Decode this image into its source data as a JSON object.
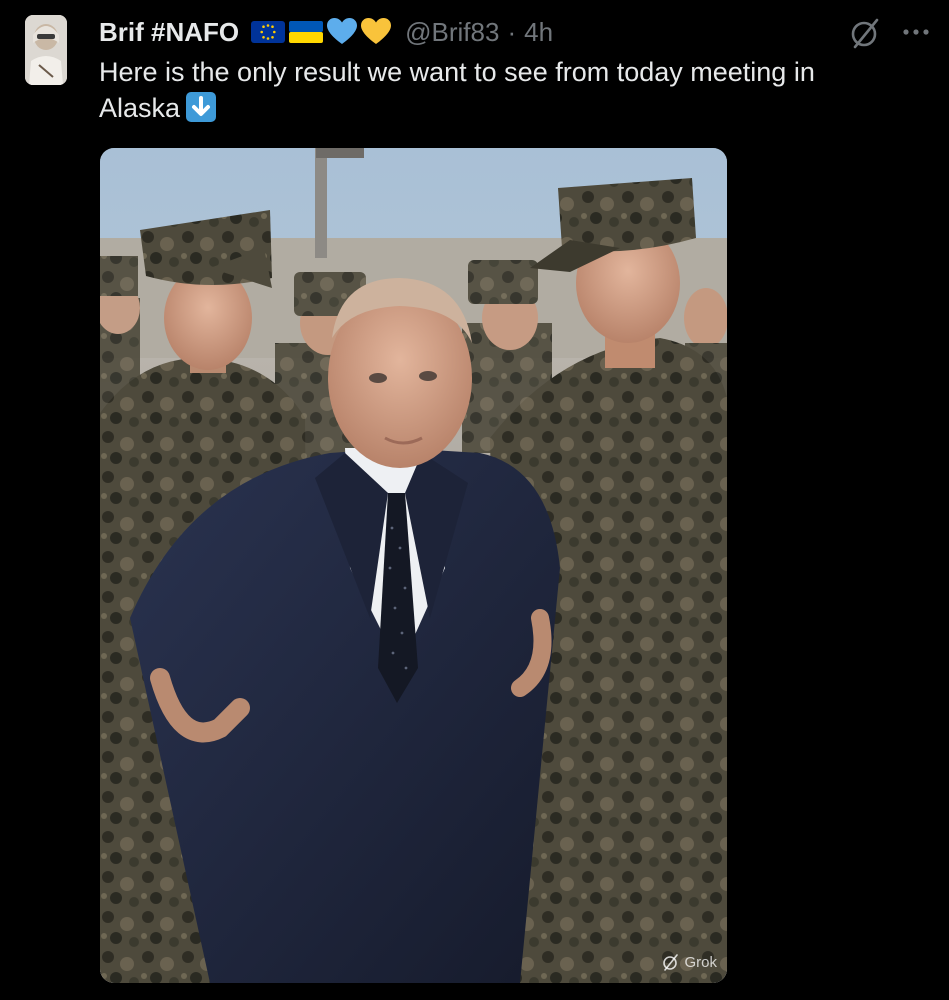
{
  "tweet": {
    "author": {
      "display_name": "Brif #NAFO",
      "handle": "@Brif83",
      "separator": "·",
      "time": "4h"
    },
    "badges": [
      "eu-flag-icon",
      "ukraine-flag-icon",
      "blue-heart-icon",
      "yellow-heart-icon"
    ],
    "text": "Here is the only result we want to see from today meeting in Alaska",
    "text_emoji": "down-arrow-emoji-icon",
    "media": {
      "watermark": "Grok"
    }
  },
  "colors": {
    "background": "#000000",
    "text_primary": "#e7e9ea",
    "text_secondary": "#71767b",
    "eu_blue": "#003399",
    "eu_star": "#ffcc00",
    "ua_blue": "#0057b7",
    "ua_yellow": "#ffd700",
    "heart_blue": "#5dadec",
    "heart_yellow": "#f9c33b",
    "emoji_arrow_bg": "#3e9ad8"
  }
}
